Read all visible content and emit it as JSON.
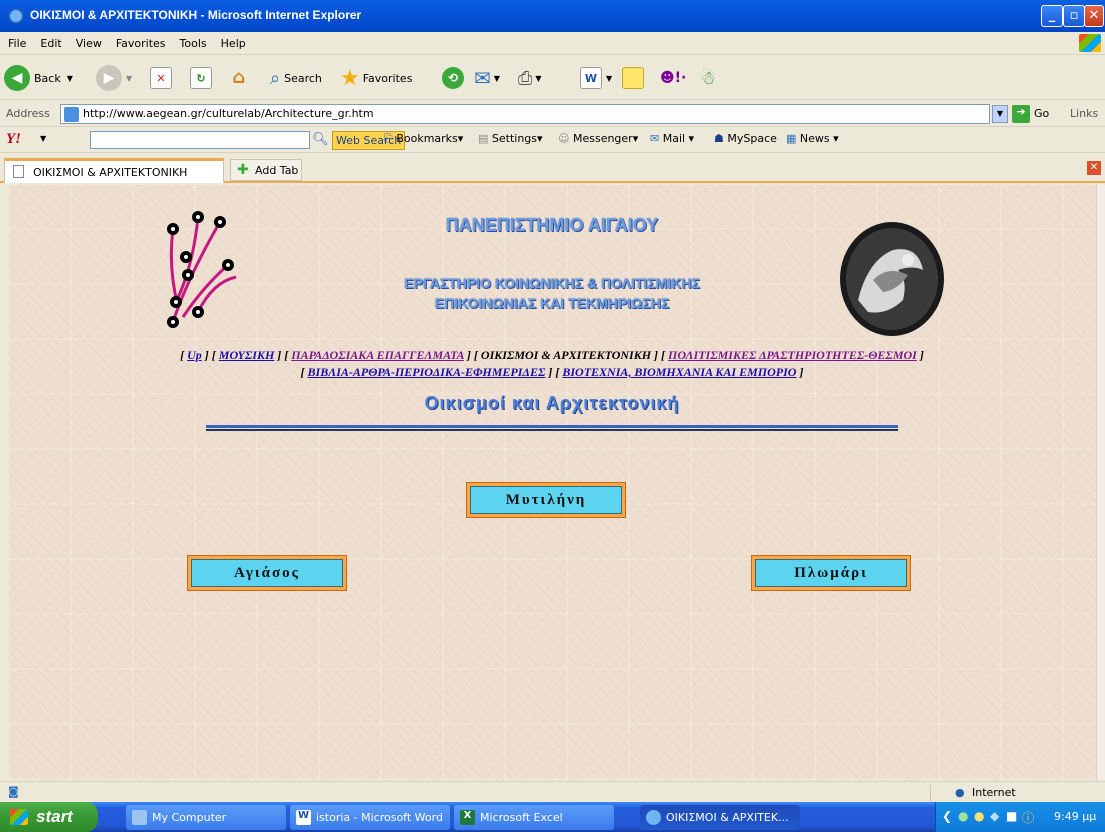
{
  "window": {
    "title": "ΟΙΚΙΣΜΟΙ & ΑΡΧΙΤΕΚΤΟΝΙΚΗ - Microsoft Internet Explorer"
  },
  "menu": [
    "File",
    "Edit",
    "View",
    "Favorites",
    "Tools",
    "Help"
  ],
  "toolbar": {
    "back": "Back",
    "search": "Search",
    "favorites": "Favorites"
  },
  "address": {
    "label": "Address",
    "url": "http://www.aegean.gr/culturelab/Architecture_gr.htm",
    "go": "Go",
    "links": "Links"
  },
  "yahoo": {
    "web_search": "Web Search",
    "bookmarks": "Bookmarks",
    "settings": "Settings",
    "messenger": "Messenger",
    "mail": "Mail",
    "myspace": "MySpace",
    "news": "News"
  },
  "tabs": {
    "active": "ΟΙΚΙΣΜΟΙ & ΑΡΧΙΤΕΚΤΟΝΙΚΗ",
    "add": "Add Tab"
  },
  "page": {
    "university": "ΠΑΝΕΠΙΣΤΗΜΙΟ ΑΙΓΑΙΟΥ",
    "lab_line1": "ΕΡΓΑΣΤΗΡΙΟ ΚΟΙΝΩΝΙΚΗΣ & ΠΟΛΙΤΙΣΜΙΚΗΣ",
    "lab_line2": "ΕΠΙΚΟΙΝΩΝΙΑΣ ΚΑΙ ΤΕΚΜΗΡΙΩΣΗΣ",
    "nav": {
      "up": "Up",
      "music": "ΜΟΥΣΙΚΗ",
      "trades": "ΠΑΡΑΔΟΣΙΑΚΑ ΕΠΑΓΓΕΛΜΑΤΑ",
      "current": "ΟΙΚΙΣΜΟΙ & ΑΡΧΙΤΕΚΤΟΝΙΚΗ",
      "cultural": "ΠΟΛΙΤΙΣΜΙΚΕΣ ΔΡΑΣΤΗΡΙΟΤΗΤΕΣ-ΘΕΣΜΟΙ",
      "books": "ΒΙΒΛΙΑ-ΑΡΘΡΑ-ΠΕΡΙΟΔΙΚΑ-ΕΦΗΜΕΡΙΔΕΣ",
      "industry": "ΒΙΟΤΕΧΝΙΑ, ΒΙΟΜΗΧΑΝΙΑ ΚΑΙ ΕΜΠΟΡΙΟ"
    },
    "heading": "Οικισμοί και Αρχιτεκτονική",
    "buttons": {
      "mytilini": "Μυτιλήνη",
      "agiasos": "Αγιάσος",
      "plomari": "Πλωμάρι"
    }
  },
  "status": {
    "zone": "Internet"
  },
  "taskbar": {
    "start": "start",
    "tasks": [
      "My Computer",
      "istoria - Microsoft Word",
      "Microsoft Excel",
      "ΟΙΚΙΣΜΟΙ & ΑΡΧΙΤΕΚ..."
    ],
    "clock": "9:49 μμ"
  }
}
